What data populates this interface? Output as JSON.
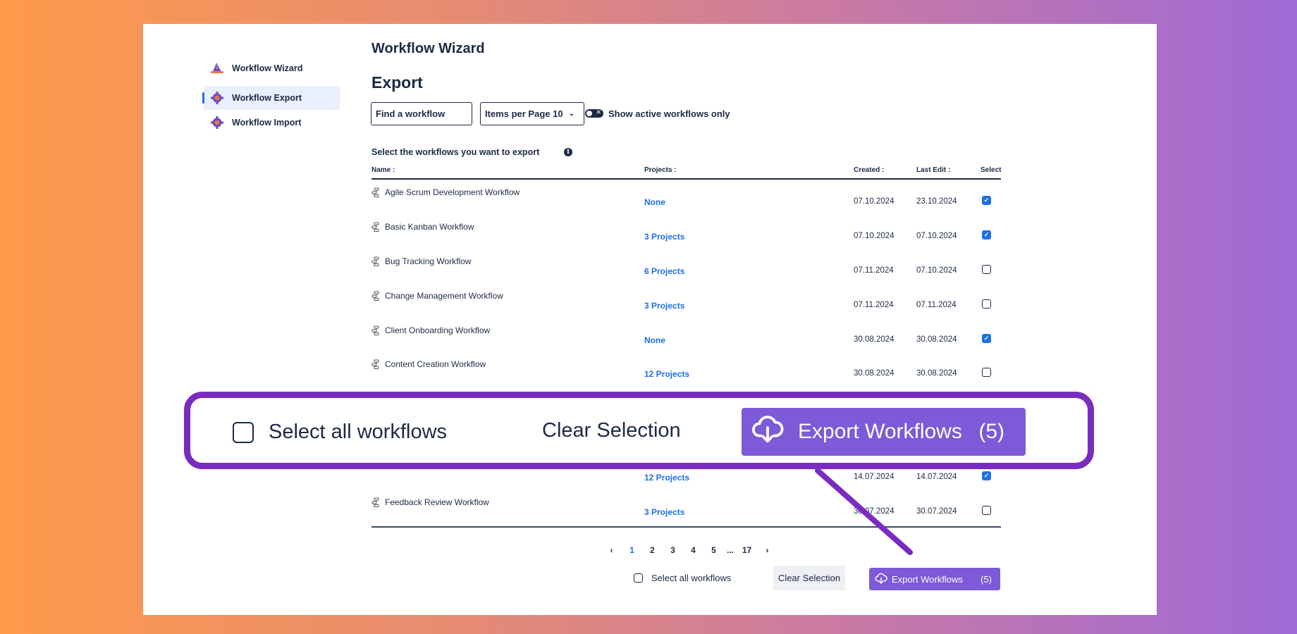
{
  "sidebar": {
    "items": [
      {
        "label": "Workflow Wizard",
        "icon": "wizard-hat-icon"
      },
      {
        "label": "Workflow Export",
        "icon": "gear-icon",
        "active": true
      },
      {
        "label": "Workflow Import",
        "icon": "gear-icon"
      }
    ]
  },
  "header": {
    "app_title": "Workflow Wizard",
    "page_title": "Export"
  },
  "controls": {
    "search_placeholder": "Find a workflow",
    "items_per_page": "Items per Page 10",
    "toggle_label": "Show active workflows only",
    "toggle_on": false
  },
  "table": {
    "intro": "Select the workflows you want to export",
    "headers": {
      "name": "Name :",
      "projects": "Projects :",
      "created": "Created :",
      "last_edit": "Last Edit :",
      "select": "Select"
    },
    "rows": [
      {
        "name": "Agile Scrum Development Workflow",
        "projects": "None",
        "created": "07.10.2024",
        "last_edit": "23.10.2024",
        "selected": true
      },
      {
        "name": "Basic Kanban Workflow",
        "projects": "3 Projects",
        "created": "07.10.2024",
        "last_edit": "07.10.2024",
        "selected": true
      },
      {
        "name": "Bug Tracking Workflow",
        "projects": "6 Projects",
        "created": "07.11.2024",
        "last_edit": "07.10.2024",
        "selected": false
      },
      {
        "name": "Change Management Workflow",
        "projects": "3 Projects",
        "created": "07.11.2024",
        "last_edit": "07.11.2024",
        "selected": false
      },
      {
        "name": "Client Onboarding Workflow",
        "projects": "None",
        "created": "30.08.2024",
        "last_edit": "30.08.2024",
        "selected": true
      },
      {
        "name": "Content Creation Workflow",
        "projects": "12 Projects",
        "created": "30.08.2024",
        "last_edit": "30.08.2024",
        "selected": false
      },
      {
        "name": "",
        "projects": "12 Projects",
        "created": "14.07.2024",
        "last_edit": "14.07.2024",
        "selected": true
      },
      {
        "name": "Feedback Review Workflow",
        "projects": "3 Projects",
        "created": "30.07.2024",
        "last_edit": "30.07.2024",
        "selected": false
      }
    ]
  },
  "pagination": {
    "prev": "‹",
    "pages": [
      "1",
      "2",
      "3",
      "4",
      "5",
      "...",
      "17"
    ],
    "current": "1",
    "next": "›"
  },
  "actions": {
    "select_all": "Select all workflows",
    "clear": "Clear Selection",
    "export": "Export Workflows",
    "export_count": "(5)"
  },
  "colors": {
    "accent": "#1f6fe5",
    "export_button": "#7c5ad8",
    "callout_border": "#7a2cbe",
    "text": "#1c2a44"
  }
}
